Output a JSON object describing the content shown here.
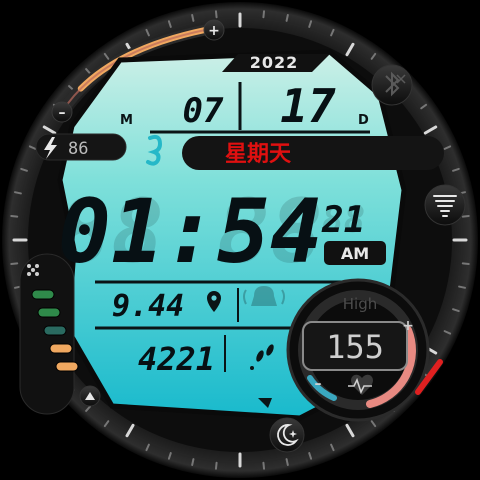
{
  "date": {
    "year": "2022",
    "month_label": "M",
    "month": "07",
    "day": "17",
    "day_label": "D"
  },
  "weekday": "星期天",
  "battery": {
    "value": "86",
    "icon": "lightning-icon"
  },
  "time": {
    "hour_minute": "01:54",
    "seconds": "21",
    "ampm": "AM"
  },
  "distance": {
    "value": "9.44",
    "icon": "location-pin-icon"
  },
  "steps": {
    "value": "4221",
    "icon": "footsteps-icon"
  },
  "heart_rate": {
    "label": "High",
    "value": "155",
    "plus": "+",
    "minus": "–",
    "icon": "heart-rate-icon"
  },
  "controls": {
    "top_plus": "+",
    "left_minus": "–"
  },
  "icons": {
    "bluetooth": "bluetooth-off-icon",
    "tornado": "tornado-icon",
    "seahorse": "seahorse-icon",
    "alarm": "alarm-bell-icon",
    "night": "moon-sparkle-icon",
    "apps": "app-grid-icon",
    "up": "triangle-up-icon"
  },
  "colors": {
    "lcd_top": "#cfeee6",
    "lcd_bottom": "#10b9cc",
    "weekday_red": "#e01010",
    "battery_arc_orange": "#f0a860",
    "hr_ring_pink": "#e88a82",
    "hr_ring_blue": "#3aa8c0",
    "red_marker": "#e02020"
  },
  "left_pills": [
    "#2f8a4a",
    "#2f8a4a",
    "#2a6a60",
    "#f0a860",
    "#f0a860"
  ]
}
